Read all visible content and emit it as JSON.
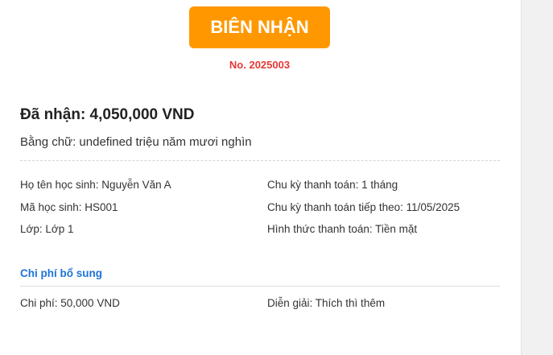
{
  "receipt": {
    "title": "BIÊN NHẬN",
    "number": "No. 2025003",
    "amount": "Đã nhận: 4,050,000 VND",
    "in_words": "Bằng chữ: undefined triệu năm mươi nghìn",
    "fields_left": [
      "Họ tên học sinh: Nguyễn Văn A",
      "Mã học sinh: HS001",
      "Lớp: Lớp 1"
    ],
    "fields_right": [
      "Chu kỳ thanh toán: 1 tháng",
      "Chu kỳ thanh toán tiếp theo: 11/05/2025",
      "Hình thức thanh toán: Tiền mặt"
    ],
    "extra_section": {
      "title": "Chi phí bổ sung",
      "cost": "Chi phí: 50,000 VND",
      "description": "Diễn giải: Thích thì thêm"
    }
  },
  "colors": {
    "title_bg": "#ff9800",
    "receipt_number": "#e53935",
    "section_title": "#1e73d8"
  }
}
